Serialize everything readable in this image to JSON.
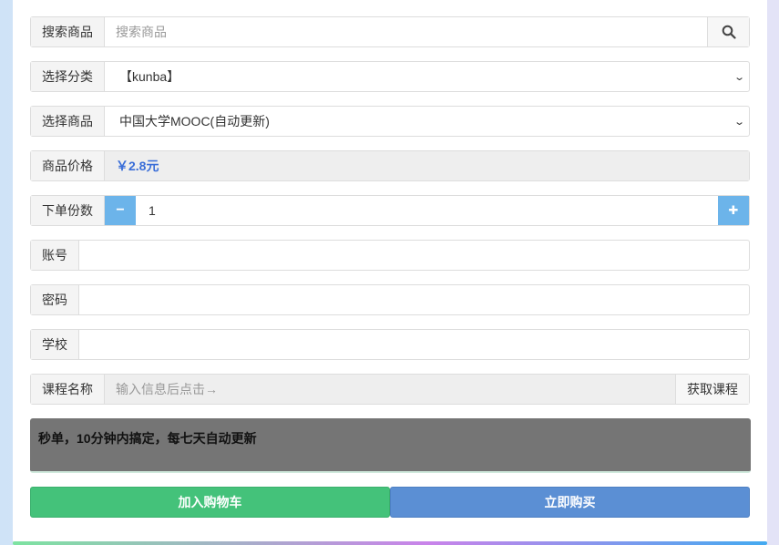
{
  "search": {
    "label": "搜索商品",
    "placeholder": "搜索商品"
  },
  "category": {
    "label": "选择分类",
    "value": "【kunba】"
  },
  "product": {
    "label": "选择商品",
    "value": "中国大学MOOC(自动更新)"
  },
  "price": {
    "label": "商品价格",
    "value": "￥2.8元"
  },
  "quantity": {
    "label": "下单份数",
    "value": "1",
    "minus": "−",
    "plus": "✚"
  },
  "account": {
    "label": "账号",
    "value": ""
  },
  "password": {
    "label": "密码",
    "value": ""
  },
  "school": {
    "label": "学校",
    "value": ""
  },
  "course": {
    "label": "课程名称",
    "placeholder": "输入信息后点击→",
    "fetch_label": "获取课程"
  },
  "notice": {
    "text": "秒单，10分钟内搞定，每七天自动更新"
  },
  "actions": {
    "cart_label": "加入购物车",
    "buy_label": "立即购买"
  },
  "colors": {
    "accent": "#6cb4ea",
    "cart": "#44c27a",
    "buy": "#5b8fd4",
    "price": "#3a6ed8",
    "notice_bg": "#757575"
  },
  "icons": {
    "search": "search-icon"
  }
}
